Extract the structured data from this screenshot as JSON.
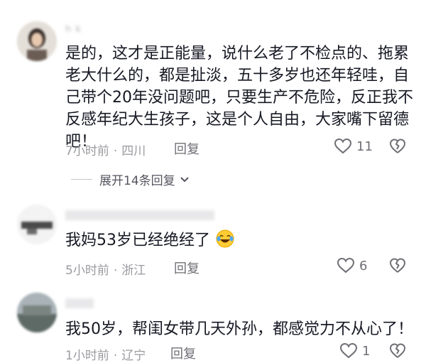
{
  "comments": [
    {
      "username": "h k",
      "text": "是的，这才是正能量，说什么老了不检点的、拖累老大什么的，都是扯淡，五十多岁也还年轻哇，自己带个20年没问题吧，只要生产不危险，反正我不反感年纪大生孩子，这是个人自由，大家嘴下留德吧！",
      "time": "7小时前",
      "location": "四川",
      "reply_label": "回复",
      "likes": "11"
    },
    {
      "username": "",
      "text": "我妈53岁已经绝经了",
      "time": "5小时前",
      "location": "浙江",
      "reply_label": "回复",
      "likes": "6"
    },
    {
      "username": "",
      "text": "我50岁，帮闺女带几天外孙，都感觉力不从心了！",
      "time": "1小时前",
      "location": "辽宁",
      "reply_label": "回复",
      "likes": "1"
    }
  ],
  "expand_replies": {
    "label": "展开14条回复"
  },
  "icons": {
    "like": "heart-outline-icon",
    "dislike": "broken-heart-icon",
    "emoji": "laughing-tears-emoji-icon",
    "expand": "chevron-down-icon"
  }
}
